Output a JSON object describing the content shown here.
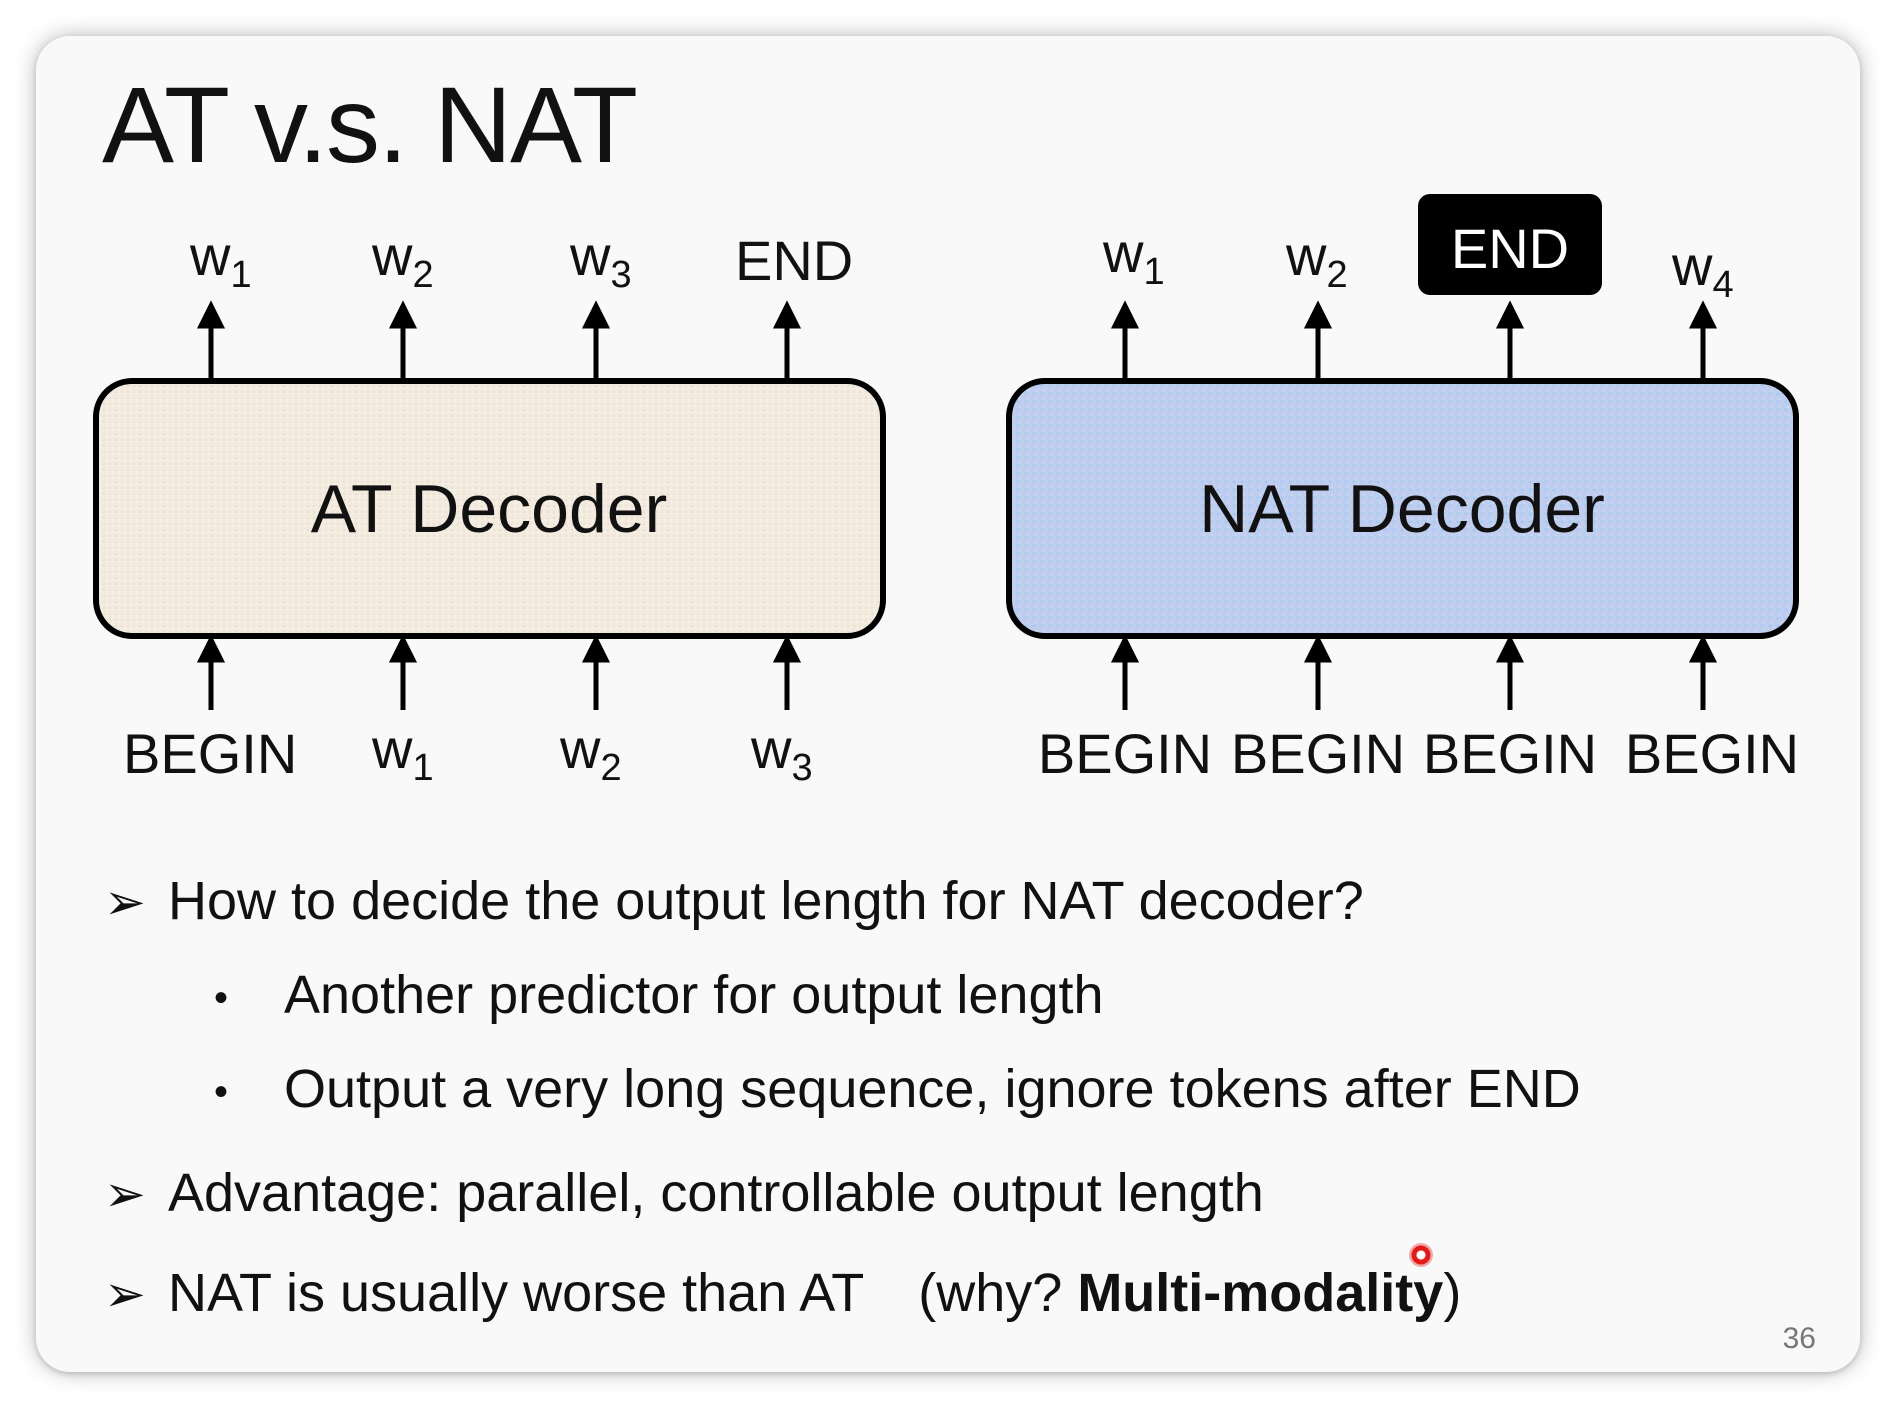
{
  "slide": {
    "title": "AT v.s. NAT",
    "page_number": "36"
  },
  "at": {
    "decoder_label": "AT Decoder",
    "outputs": [
      {
        "base": "w",
        "sub": "1"
      },
      {
        "base": "w",
        "sub": "2"
      },
      {
        "base": "w",
        "sub": "3"
      },
      {
        "base": "END",
        "sub": ""
      }
    ],
    "inputs": [
      {
        "base": "BEGIN",
        "sub": ""
      },
      {
        "base": "w",
        "sub": "1"
      },
      {
        "base": "w",
        "sub": "2"
      },
      {
        "base": "w",
        "sub": "3"
      }
    ],
    "fill_color": "#f3ebdf"
  },
  "nat": {
    "decoder_label": "NAT Decoder",
    "outputs": [
      {
        "base": "w",
        "sub": "1"
      },
      {
        "base": "w",
        "sub": "2"
      },
      {
        "base": "END",
        "sub": "",
        "highlight": true
      },
      {
        "base": "w",
        "sub": "4"
      }
    ],
    "inputs": [
      {
        "base": "BEGIN",
        "sub": ""
      },
      {
        "base": "BEGIN",
        "sub": ""
      },
      {
        "base": "BEGIN",
        "sub": ""
      },
      {
        "base": "BEGIN",
        "sub": ""
      }
    ],
    "fill_color": "#b9cdee",
    "highlight_color": "#000000"
  },
  "bullets": {
    "q1": "How to decide the output length for NAT decoder?",
    "q1_sub1": "Another predictor for output length",
    "q1_sub2": "Output a very long sequence, ignore tokens after END",
    "advantage": "Advantage: parallel, controllable output length",
    "nat_worse": "NAT is usually worse than AT",
    "why_open": "(why? ",
    "why_bold": "Multi-modality",
    "why_close": ")"
  }
}
